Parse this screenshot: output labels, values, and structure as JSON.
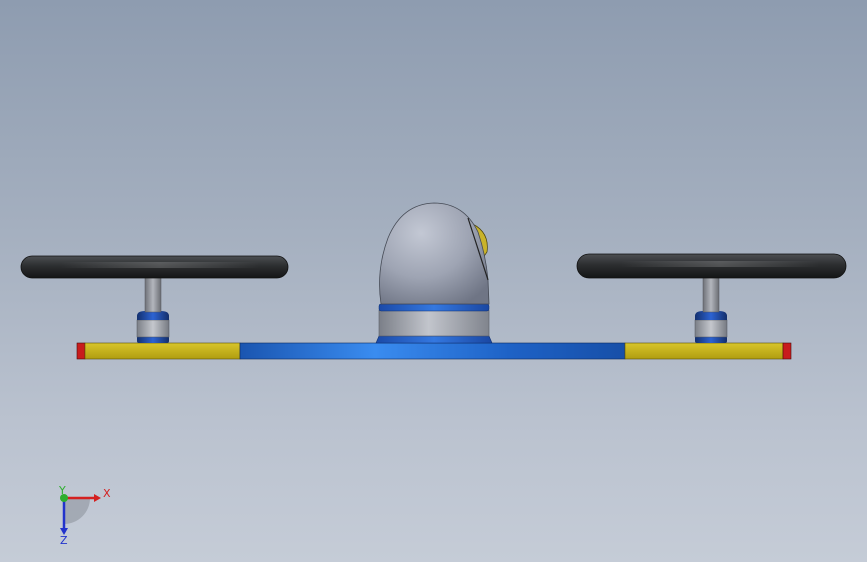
{
  "colors": {
    "background_top": "#8e9cb0",
    "background_bottom": "#c5ccd7",
    "frame_center": "#1a63c4",
    "frame_ends": "#c6b318",
    "end_caps": "#d01e1e",
    "rotor_disc": "#2f3133",
    "motor_blue": "#1f4cae",
    "shaft_gray": "#8c8f96",
    "dome_gray": "#a4aab8",
    "dome_sensor": "#c9b32a",
    "axis_x": "#d42020",
    "axis_y": "#2fae2f",
    "axis_z": "#2233cc"
  },
  "triad": {
    "x_label": "X",
    "y_label": "Y",
    "z_label": "Z"
  }
}
